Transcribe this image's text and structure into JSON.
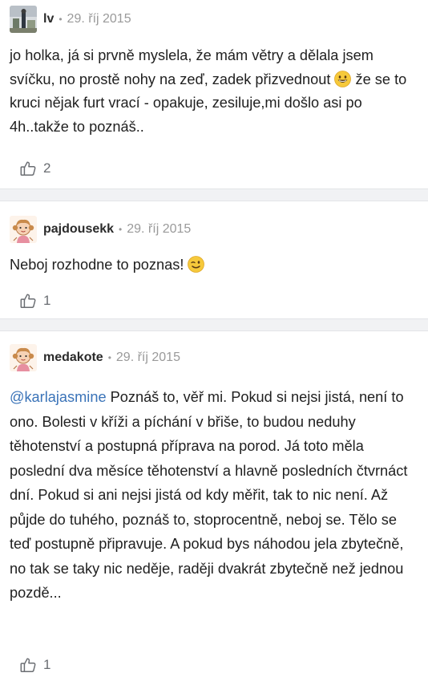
{
  "comments": [
    {
      "username": "lv",
      "dot": "•",
      "date": "29. říj 2015",
      "text_before_emoji": "jo holka, já si prvně myslela, že mám větry a dělala jsem svíčku, no prostě nohy na zeď, zadek přizvednout",
      "text_after_emoji": " že se to kruci nějak furt vrací - opakuje, zesiluje,mi došlo asi po 4h..takže to poznáš..",
      "emoji": "grinning-face-icon",
      "likes": "2"
    },
    {
      "username": "pajdousekk",
      "dot": "•",
      "date": "29. říj 2015",
      "text_before_emoji": "Neboj rozhodne to poznas!",
      "emoji": "winking-face-icon",
      "likes": "1"
    },
    {
      "username": "medakote",
      "dot": "•",
      "date": "29. říj 2015",
      "mention": "@karlajasmine",
      "text": " Poznáš to, věř mi. Pokud si nejsi jistá, není to ono. Bolesti v kříži a píchání v břiše, to budou neduhy těhotenství a postupná příprava na porod. Já toto měla poslední dva měsíce těhotenství a hlavně posledních čtvrnáct dní. Pokud si ani nejsi jistá od kdy měřit, tak to nic není. Až půjde do tuhého, poznáš to, stoprocentně, neboj se. Tělo se teď postupně připravuje. A pokud bys náhodou jela zbytečně, no tak se taky nic neděje, raději dvakrát zbytečně než jednou pozdě...",
      "likes": "1"
    }
  ],
  "colors": {
    "mention": "#3a73b8",
    "separator": "#f1f2f4",
    "meta": "#9a9a9a"
  }
}
